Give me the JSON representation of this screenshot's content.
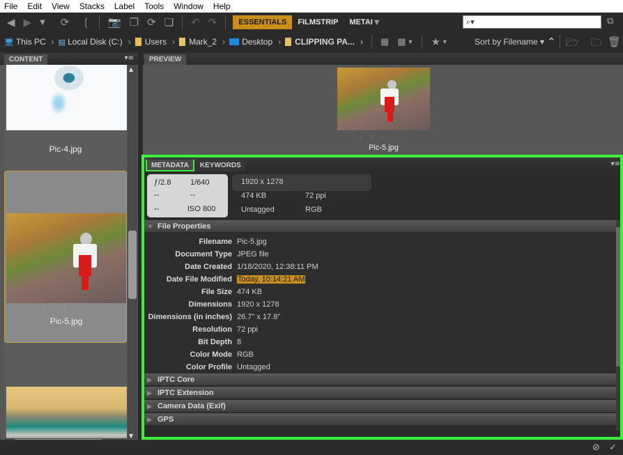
{
  "menu": [
    "File",
    "Edit",
    "View",
    "Stacks",
    "Label",
    "Tools",
    "Window",
    "Help"
  ],
  "toolbar": {
    "icons": [
      "back-arrow-icon",
      "forward-arrow-icon",
      "dropdown-icon",
      "boomerang-icon",
      "rotate-icon",
      "camera-import-icon",
      "copy-icon",
      "refine-icon",
      "output-icon",
      "undo-icon",
      "redo-icon"
    ],
    "workspaces": [
      "ESSENTIALS",
      "FILMSTRIP",
      "METAI"
    ],
    "active_workspace": "ESSENTIALS",
    "search_placeholder": "⌕▾"
  },
  "pathbar": {
    "crumbs": [
      "This PC",
      "Local Disk (C:)",
      "Users",
      "Mark_2",
      "Desktop",
      "CLIPPING PA..."
    ],
    "sort_label": "Sort by Filename ▾"
  },
  "content_panel": {
    "tab": "CONTENT",
    "items": [
      {
        "label": "Pic-4.jpg",
        "selected": false
      },
      {
        "label": "Pic-5.jpg",
        "selected": true
      },
      {
        "label": "",
        "selected": false
      }
    ],
    "rating_dots": ". . . . ."
  },
  "preview_panel": {
    "tab": "PREVIEW",
    "filename": "Pic-5.jpg",
    "rating_dots": ". . . . ."
  },
  "metadata_panel": {
    "tabs": [
      "METADATA",
      "KEYWORDS"
    ],
    "placard": {
      "aperture": "ƒ/2.8",
      "shutter": "1/640",
      "r2c1": "--",
      "r2c2": "--",
      "r3c1": "--",
      "iso": "ISO 800"
    },
    "info": {
      "dimensions": "1920 x 1278",
      "size": "474 KB",
      "resolution": "72 ppi",
      "profile": "Untagged",
      "mode": "RGB"
    },
    "file_properties_title": "File Properties",
    "file_properties": [
      {
        "k": "Filename",
        "v": "Pic-5.jpg"
      },
      {
        "k": "Document Type",
        "v": "JPEG file"
      },
      {
        "k": "Date Created",
        "v": "1/18/2020, 12:38:11 PM"
      },
      {
        "k": "Date File Modified",
        "v": "Today, 10:14:21 AM",
        "highlight": true
      },
      {
        "k": "File Size",
        "v": "474 KB"
      },
      {
        "k": "Dimensions",
        "v": "1920 x 1278"
      },
      {
        "k": "Dimensions (in inches)",
        "v": "26.7\" x 17.8\""
      },
      {
        "k": "Resolution",
        "v": "72 ppi"
      },
      {
        "k": "Bit Depth",
        "v": "8"
      },
      {
        "k": "Color Mode",
        "v": "RGB"
      },
      {
        "k": "Color Profile",
        "v": "Untagged"
      }
    ],
    "collapsed_sections": [
      "IPTC Core",
      "IPTC Extension",
      "Camera Data (Exif)",
      "GPS"
    ]
  },
  "colors": {
    "accent": "#c8901a",
    "highlight_border": "#3cf03c",
    "panel_bg": "#575757"
  }
}
